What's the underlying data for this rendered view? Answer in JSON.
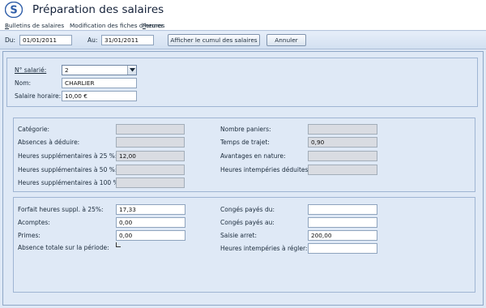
{
  "window": {
    "title": "Préparation des salaires"
  },
  "menu": {
    "items": [
      {
        "label": "Bulletins de salaires",
        "mnemonic": "B",
        "rest": "ulletins de salaires"
      },
      {
        "label": "Modification des fiches d'heures"
      },
      {
        "label": "Fermer",
        "mnemonic": "F",
        "rest": "ermer"
      }
    ]
  },
  "toolbar": {
    "du_label": "Du:",
    "du_value": "01/01/2011",
    "au_label": "Au:",
    "au_value": "31/01/2011",
    "cumul_button": "Afficher le cumul des salaires",
    "annuler_button": "Annuler"
  },
  "employee": {
    "numero_label": "N° salarié:",
    "numero_value": "2",
    "nom_label": "Nom:",
    "nom_value": "CHARLIER",
    "salaire_label": "Salaire horaire:",
    "salaire_value": "10,00 €"
  },
  "details": {
    "categorie_label": "Catégorie:",
    "categorie_value": "",
    "absences_label": "Absences à déduire:",
    "absences_value": "",
    "hs25_label": "Heures supplémentaires à 25 %:",
    "hs25_value": "12,00",
    "hs50_label": "Heures supplémentaires à 50 %:",
    "hs50_value": "",
    "hs100_label": "Heures supplémentaires à 100 %:",
    "hs100_value": "",
    "paniers_label": "Nombre paniers:",
    "paniers_value": "",
    "trajet_label": "Temps de trajet:",
    "trajet_value": "0,90",
    "avantages_label": "Avantages en nature:",
    "avantages_value": "",
    "intemperies_deduites_label": "Heures intempéries déduites:",
    "intemperies_deduites_value": ""
  },
  "adjustments": {
    "forfait_label": "Forfait heures suppl. à 25%:",
    "forfait_value": "17,33",
    "acomptes_label": "Acomptes:",
    "acomptes_value": "0,00",
    "primes_label": "Primes:",
    "primes_value": "0,00",
    "absence_label": "Absence totale sur la période:",
    "absence_checked": false,
    "conges_du_label": "Congés payés du:",
    "conges_du_value": "",
    "conges_au_label": "Congés payés au:",
    "conges_au_value": "",
    "saisie_label": "Saisie arret:",
    "saisie_value": "200,00",
    "intemperies_regler_label": "Heures intempéries à régler:",
    "intemperies_regler_value": ""
  },
  "icons": {
    "logo": "app-logo-icon",
    "dropdown": "chevron-down-icon"
  },
  "colors": {
    "accent": "#2e5da8",
    "panel_border": "#8fa7c7",
    "background": "#dfe9f6"
  }
}
